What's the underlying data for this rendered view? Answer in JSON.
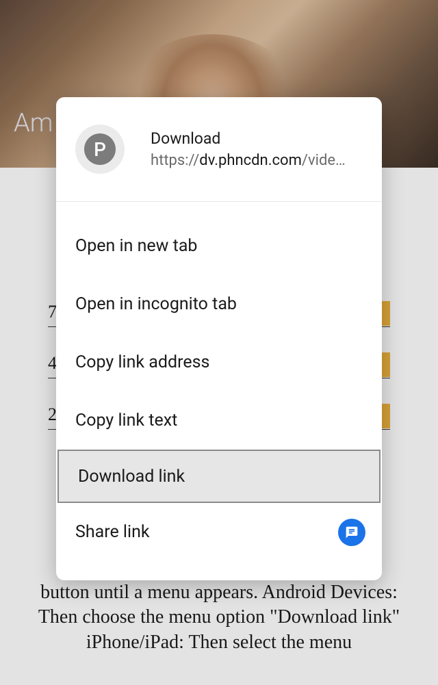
{
  "background": {
    "overlay_text": "Am",
    "rows": [
      {
        "num": "7"
      },
      {
        "num": "4"
      },
      {
        "num": "2"
      }
    ],
    "instruction_text": "button until a menu appears. Android Devices: Then choose the menu option \"Download link\" iPhone/iPad: Then select the menu"
  },
  "menu": {
    "avatar_letter": "P",
    "header_title": "Download",
    "header_url_prefix": "https://",
    "header_url_dark": "dv.phncdn.com",
    "header_url_suffix": "/vide…",
    "items": [
      {
        "label": "Open in new tab"
      },
      {
        "label": "Open in incognito tab"
      },
      {
        "label": "Copy link address"
      },
      {
        "label": "Copy link text"
      },
      {
        "label": "Download link"
      },
      {
        "label": "Share link"
      }
    ]
  }
}
